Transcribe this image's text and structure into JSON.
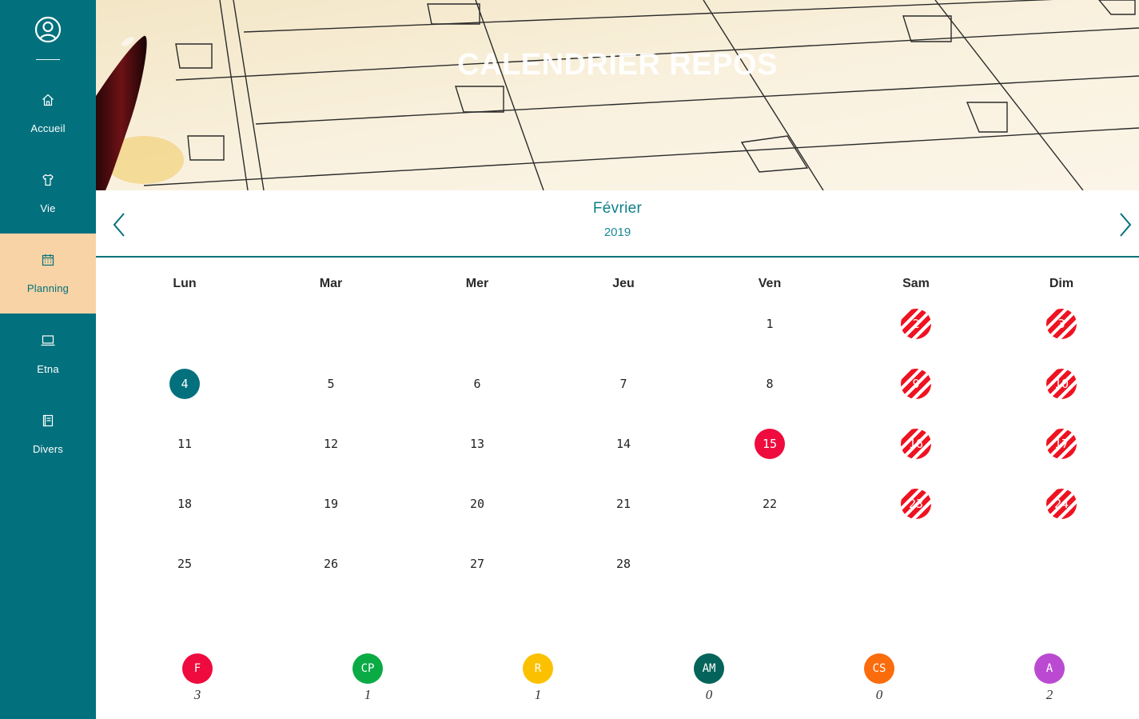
{
  "sidebar": {
    "profile_icon": "user-circle-icon",
    "items": [
      {
        "key": "accueil",
        "label": "Accueil",
        "icon": "home-icon"
      },
      {
        "key": "vie",
        "label": "Vie",
        "icon": "shirt-icon"
      },
      {
        "key": "planning",
        "label": "Planning",
        "icon": "calendar-icon",
        "active": true
      },
      {
        "key": "etna",
        "label": "Etna",
        "icon": "laptop-icon"
      },
      {
        "key": "divers",
        "label": "Divers",
        "icon": "book-icon"
      }
    ]
  },
  "banner": {
    "title": "CALENDRIER REPOS"
  },
  "calendar": {
    "month": "Février",
    "year": "2019",
    "prev_icon": "chevron-left-icon",
    "next_icon": "chevron-right-icon",
    "weekdays": [
      "Lun",
      "Mar",
      "Mer",
      "Jeu",
      "Ven",
      "Sam",
      "Dim"
    ],
    "weeks": [
      [
        null,
        null,
        null,
        null,
        {
          "d": "1"
        },
        {
          "d": "2",
          "type": "weekend"
        },
        {
          "d": "3",
          "type": "weekend"
        }
      ],
      [
        {
          "d": "4",
          "type": "today"
        },
        {
          "d": "5"
        },
        {
          "d": "6"
        },
        {
          "d": "7"
        },
        {
          "d": "8"
        },
        {
          "d": "9",
          "type": "weekend"
        },
        {
          "d": "10",
          "type": "weekend"
        }
      ],
      [
        {
          "d": "11"
        },
        {
          "d": "12"
        },
        {
          "d": "13"
        },
        {
          "d": "14"
        },
        {
          "d": "15",
          "type": "holiday"
        },
        {
          "d": "16",
          "type": "weekend"
        },
        {
          "d": "17",
          "type": "weekend"
        }
      ],
      [
        {
          "d": "18"
        },
        {
          "d": "19"
        },
        {
          "d": "20"
        },
        {
          "d": "21"
        },
        {
          "d": "22"
        },
        {
          "d": "23",
          "type": "weekend"
        },
        {
          "d": "24",
          "type": "weekend"
        }
      ],
      [
        {
          "d": "25"
        },
        {
          "d": "26"
        },
        {
          "d": "27"
        },
        {
          "d": "28"
        },
        null,
        null,
        null
      ]
    ]
  },
  "legend": [
    {
      "code": "F",
      "count": "3",
      "color": "#ef0b3d"
    },
    {
      "code": "CP",
      "count": "1",
      "color": "#0aaa45"
    },
    {
      "code": "R",
      "count": "1",
      "color": "#fbc100"
    },
    {
      "code": "AM",
      "count": "0",
      "color": "#04645b"
    },
    {
      "code": "CS",
      "count": "0",
      "color": "#fb6c0c"
    },
    {
      "code": "A",
      "count": "2",
      "color": "#bb4ad2"
    }
  ],
  "colors": {
    "primary": "#03717d",
    "active_nav": "#f7d3a5",
    "holiday": "#ef0b3d",
    "weekend_stripe": "#ef1322"
  }
}
